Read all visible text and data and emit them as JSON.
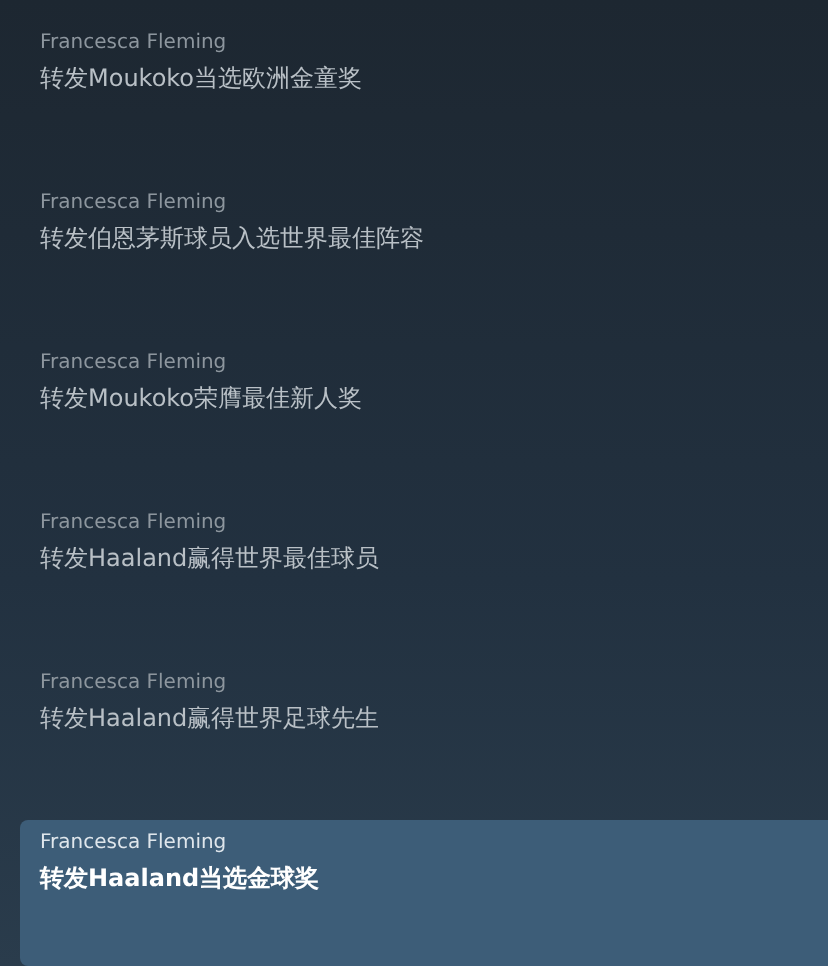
{
  "items": [
    {
      "author": "Francesca Fleming",
      "title": "转发Moukoko当选欧洲金童奖",
      "selected": false
    },
    {
      "author": "Francesca Fleming",
      "title": "转发伯恩茅斯球员入选世界最佳阵容",
      "selected": false
    },
    {
      "author": "Francesca Fleming",
      "title": "转发Moukoko荣膺最佳新人奖",
      "selected": false
    },
    {
      "author": "Francesca Fleming",
      "title": "转发Haaland赢得世界最佳球员",
      "selected": false
    },
    {
      "author": "Francesca Fleming",
      "title": "转发Haaland赢得世界足球先生",
      "selected": false
    },
    {
      "author": "Francesca Fleming",
      "title": "转发Haaland当选金球奖",
      "selected": true
    }
  ]
}
